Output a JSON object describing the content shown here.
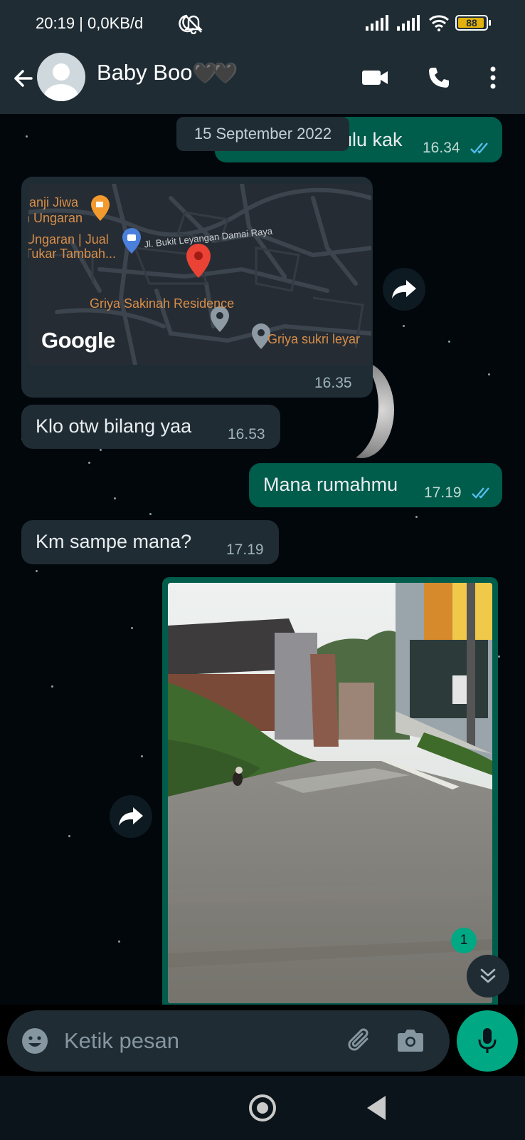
{
  "status_bar": {
    "time_net": "20:19 | 0,0KB/d",
    "battery": "88"
  },
  "header": {
    "contact_name": "Baby Boo",
    "hearts": "🖤🖤"
  },
  "chat": {
    "date_pill": "15 September 2022",
    "messages": [
      {
        "direction": "out",
        "text": "ulu kak",
        "time": "16.34",
        "read": true
      },
      {
        "direction": "in",
        "type": "location",
        "time": "16.35",
        "map_labels": [
          "Janji Jiwa",
          "n Ungaran",
          "Ungaran | Jual",
          "Tukar Tambah...",
          "Jl. Bukit Leyangan Damai Raya",
          "Griya Sakinah Residence",
          "Griya sukri leyar"
        ],
        "map_brand": "Google"
      },
      {
        "direction": "in",
        "text": "Klo otw bilang yaa",
        "time": "16.53"
      },
      {
        "direction": "out",
        "text": "Mana rumahmu",
        "time": "17.19",
        "read": true
      },
      {
        "direction": "in",
        "text": "Km sampe mana?",
        "time": "17.19"
      },
      {
        "direction": "out",
        "type": "image"
      }
    ],
    "unread_count": "1"
  },
  "composer": {
    "placeholder": "Ketik pesan"
  },
  "colors": {
    "incoming": "#1f2c34",
    "outgoing": "#005c4b",
    "accent": "#00a884",
    "read_ticks": "#53bdeb"
  }
}
